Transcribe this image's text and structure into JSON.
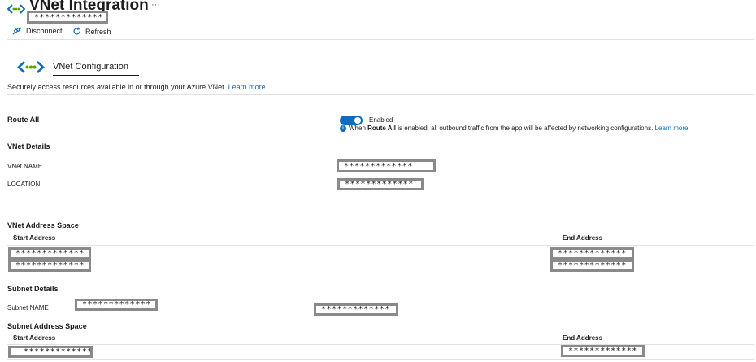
{
  "header": {
    "title": "VNet Integration",
    "more": "···",
    "subtitle_masked": "*************"
  },
  "toolbar": {
    "disconnect_label": "Disconnect",
    "refresh_label": "Refresh"
  },
  "config": {
    "heading": "VNet Configuration",
    "description": "Securely access resources available in or through your Azure VNet.",
    "learn_more": "Learn more"
  },
  "route_all": {
    "label": "Route All",
    "toggle_state": "Enabled",
    "info_prefix": "When",
    "info_bold": "Route All",
    "info_suffix": "is enabled, all outbound traffic from the app will be affected by networking configurations.",
    "learn_more": "Learn more"
  },
  "vnet_details": {
    "heading": "VNet Details",
    "name_label": "VNet NAME",
    "name_value": "*************",
    "location_label": "LOCATION",
    "location_value": "*************"
  },
  "address_space": {
    "heading": "VNet Address Space",
    "start_header": "Start Address",
    "end_header": "End Address",
    "rows": [
      {
        "start": "*************",
        "end": "*************"
      },
      {
        "start": "*************",
        "end": "*************"
      }
    ]
  },
  "subnet": {
    "heading": "Subnet Details",
    "name_label": "Subnet NAME",
    "name_value": "*************",
    "extra_value": "*************"
  },
  "subnet_space": {
    "heading": "Subnet Address Space",
    "start_header": "Start Address",
    "end_header": "End Address",
    "start_value": "*************",
    "end_value": "*************"
  },
  "colors": {
    "accent": "#0f6cbd",
    "mask_border": "#8a8a8a"
  }
}
